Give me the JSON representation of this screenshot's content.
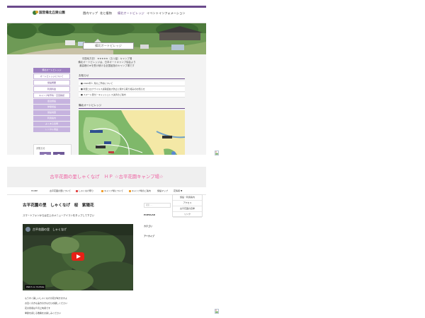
{
  "shot1": {
    "logo_text": "国営備北丘陵公園",
    "nav": [
      "園内マップ",
      "花と植物",
      "備北オートビレッジ",
      "イベント",
      "インフォメーション"
    ],
    "hero_title": "備北オートビレッジ",
    "intro": [
      "中国地方初！ ★★★★★（五つ星）キャンプ場",
      "備北オートビレッジは、日本オートキャンプ協会より",
      "最高峰の★を受け続ける全国屈指のキャンプ場です"
    ],
    "sidenav": [
      {
        "label": "備北オートビレッジ",
        "style": "dark"
      },
      {
        "label": "オートビレッジについて",
        "style": "light"
      },
      {
        "label": "施設概要",
        "style": "light"
      },
      {
        "label": "利用料金",
        "style": "light"
      },
      {
        "label": "キャンプ場予約・空室確認",
        "style": "light"
      },
      {
        "label": "宿泊施設",
        "style": "mid"
      },
      {
        "label": "体験施設",
        "style": "mid"
      },
      {
        "label": "施設地図",
        "style": "mid"
      },
      {
        "label": "利用案内",
        "style": "mid"
      },
      {
        "label": "よくある質問",
        "style": "mid"
      },
      {
        "label": "レンタル用品",
        "style": "mid"
      }
    ],
    "side_bottom_label": "お知らせ",
    "news_heading": "お知らせ",
    "news": [
      "■ 2020年１ 月のご予約について",
      "■ 新型コロナウイルス感染症拡大防止に関する取り組みのお知らせ",
      "■ スマート受付・キャッシュレス決済のご案内"
    ],
    "map_heading": "備北オートビレッジ"
  },
  "shot2": {
    "title": "古平花園の里しゃくなげ　ＨＰ ☆古平花園キャンプ場☆",
    "nav": [
      {
        "label": "HOME",
        "dot": ""
      },
      {
        "label": "古平花園の里について",
        "dot": ""
      },
      {
        "label": "しゃくなげ祭り",
        "dot": "#e24a4a"
      },
      {
        "label": "キャンプ場について",
        "dot": "#f0a030"
      },
      {
        "label": "キャンプ場のご案内",
        "dot": "#f0a030"
      },
      {
        "label": "施設マップ",
        "dot": ""
      },
      {
        "label": "花情報 ▼",
        "dot": ""
      }
    ],
    "dropdown": [
      "施設・利用案内",
      "アクセス",
      "古平花園の四季",
      "リンク"
    ],
    "post_title": "古平花園の里　しゃくなげ　桜　紫陽花",
    "post_sub": "スマートフォンからは左上のメニューアイコンをタップして下さい",
    "video_title": "古平花園の里　しゃくなげ",
    "video_watch": "Watch on YouTube",
    "search_placeholder": "検索 …",
    "side": [
      "POPULAR",
      "カテゴリ",
      "アーカイブ"
    ],
    "body": [
      "　もうすぐ美しいしゃくなげの花が咲きますよ",
      "　お近くの方も遠方の方もぜひお越しください",
      "　花の見頃は５月上旬頃です",
      "　季節を感じる散策をお楽しみください"
    ]
  }
}
